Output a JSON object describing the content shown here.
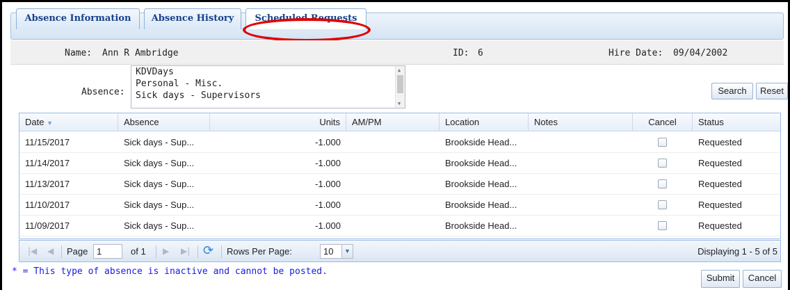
{
  "tabs": [
    {
      "label": "Absence Information"
    },
    {
      "label": "Absence History"
    },
    {
      "label": "Scheduled Requests"
    }
  ],
  "employee": {
    "name_label": "Name:",
    "name_value": "Ann R Ambridge",
    "id_label": "ID:",
    "id_value": "6",
    "hire_label": "Hire Date:",
    "hire_value": "09/04/2002"
  },
  "filter": {
    "absence_label": "Absence:",
    "options": [
      "KDVDays",
      "Personal - Misc.",
      "Sick days - Supervisors"
    ],
    "search_label": "Search",
    "reset_label": "Reset"
  },
  "grid": {
    "columns": [
      "Date",
      "Absence",
      "Units",
      "AM/PM",
      "Location",
      "Notes",
      "Cancel",
      "Status"
    ],
    "rows": [
      {
        "date": "11/15/2017",
        "absence": "Sick days - Sup...",
        "units": "-1.000",
        "ampm": "",
        "location": "Brookside Head...",
        "notes": "",
        "cancel": false,
        "status": "Requested"
      },
      {
        "date": "11/14/2017",
        "absence": "Sick days - Sup...",
        "units": "-1.000",
        "ampm": "",
        "location": "Brookside Head...",
        "notes": "",
        "cancel": false,
        "status": "Requested"
      },
      {
        "date": "11/13/2017",
        "absence": "Sick days - Sup...",
        "units": "-1.000",
        "ampm": "",
        "location": "Brookside Head...",
        "notes": "",
        "cancel": false,
        "status": "Requested"
      },
      {
        "date": "11/10/2017",
        "absence": "Sick days - Sup...",
        "units": "-1.000",
        "ampm": "",
        "location": "Brookside Head...",
        "notes": "",
        "cancel": false,
        "status": "Requested"
      },
      {
        "date": "11/09/2017",
        "absence": "Sick days - Sup...",
        "units": "-1.000",
        "ampm": "",
        "location": "Brookside Head...",
        "notes": "",
        "cancel": false,
        "status": "Requested"
      }
    ]
  },
  "paging": {
    "page_label": "Page",
    "page_value": "1",
    "of_label": "of 1",
    "rows_label": "Rows Per Page:",
    "rows_value": "10",
    "display_text": "Displaying 1 - 5 of 5"
  },
  "footnote": "* = This type of absence is inactive and cannot be posted.",
  "actions": {
    "submit_label": "Submit",
    "cancel_label": "Cancel"
  },
  "colors": {
    "tab_text": "#15428b",
    "highlight_ring": "#e00000",
    "footnote_text": "#1a1ae6"
  }
}
